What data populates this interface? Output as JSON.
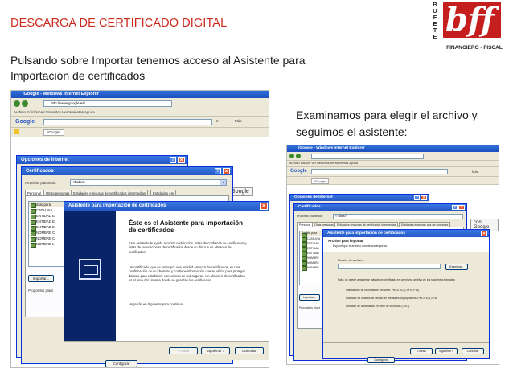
{
  "slide": {
    "title": "DESCARGA DE CERTIFICADO DIGITAL",
    "intro": "Pulsando sobre Importar tenemos acceso al Asistente para Importación de certificados",
    "right_text": "Examinamos para elegir el archivo y seguimos el asistente:"
  },
  "logo": {
    "letters": [
      "B",
      "U",
      "F",
      "E",
      "T",
      "E"
    ],
    "mark": "bff",
    "subtitle": "FINANCIERO - FISCAL"
  },
  "colors": {
    "title": "#cc2a1c",
    "xp_blue": "#2458c8",
    "dialog_bg": "#ece9d8"
  },
  "left_screenshot": {
    "ie_title": "iGoogle - Windows Internet Explorer",
    "menu": "Archivo   Edición   Ver   Favoritos   Herramientas   Ayuda",
    "address": "http://www.google.es/",
    "search_label": "Google",
    "search_ok": "Ir",
    "mas": "Más",
    "favorites_tab": "iGoogle",
    "google_button": "con Google",
    "options_title": "Opciones de Internet",
    "certs_title": "Certificados",
    "purpose_label": "Propósito planteado:",
    "purpose_value": "<Todos>",
    "tabs": [
      "Personal",
      "Otras personas",
      "Entidades emisoras de certificados intermedias",
      "Entidades em"
    ],
    "list_header": "Emitido para",
    "list_items": [
      "CATALINA",
      "ENTIDAD E",
      "ENTIDAD E",
      "ENTIDAD E",
      "NOMBRE C",
      "NOMBRE C",
      "NOMBRE L"
    ],
    "import_button": "Importar...",
    "purposes_label": "Propósitos plant",
    "config_button": "Configurar",
    "wizard_title": "Asistente para importación de certificados",
    "wizard_heading": "Éste es el Asistente para importación de certificados",
    "wizard_p1": "Este asistente le ayuda a copiar certificados, listas de confianza de certificados y listas de revocaciones de certificados desde su disco a un almacén de certificados.",
    "wizard_p2": "Un certificado, que se emite por una entidad emisora de certificados, es una confirmación de su identidad y contiene información que se utiliza para proteger datos o para establecer conexiones de red seguras. Un almacén de certificados es el área del sistema donde se guardan los certificados.",
    "wizard_p3": "Haga clic en Siguiente para continuar.",
    "back_button": "< Atrás",
    "next_button": "Siguiente >",
    "cancel_button": "Cancelar"
  },
  "right_screenshot": {
    "ie_title": "iGoogle - Windows Internet Explorer",
    "menu": "Archivo   Edición   Ver   Favoritos   Herramientas   Ayuda",
    "search_label": "Google",
    "mas": "Más",
    "favorites_tab": "iGoogle",
    "google_button": "con Google",
    "options_title": "Opciones de Internet",
    "certs_title": "Certificados",
    "purpose_label": "Propósito planteado:",
    "purpose_value": "<Todos>",
    "tabs": [
      "Personal",
      "Otras personas",
      "Entidades emisoras de certificados intermedias",
      "Entidades emisoras raíz de confianza"
    ],
    "list_header": "Emitido para",
    "list_items": [
      "CATALINA",
      "ENTIDAD",
      "ENTIDAD",
      "ENTIDAD",
      "NOMBRE",
      "NOMBRE",
      "NOMBRE"
    ],
    "import_button": "Importar...",
    "purposes_label": "Propósitos plant",
    "config_button": "Configurar",
    "wizard_title": "Asistente para importación de certificados",
    "wizard_heading": "Archivo para importar",
    "wizard_sub": "Especifique el archivo que desea importar.",
    "file_label": "Nombre de archivo:",
    "browse_button": "Examinar...",
    "note": "Nota: se puede almacenar más de un certificado en un mismo archivo en los siguientes formatos:",
    "formats": [
      "Intercambio de información personal: PKCS #12 (.PFX,.P12)",
      "Estándar de sintaxis de cifrado de mensajes criptográficos: PKCS #7 (.P7B)",
      "Almacén de certificados en serie de Microsoft (.SST)"
    ],
    "back_button": "< Atrás",
    "next_button": "Siguiente >",
    "cancel_button": "Cancelar"
  }
}
